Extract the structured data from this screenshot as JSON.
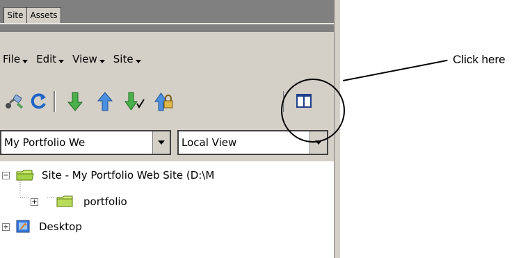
{
  "tabs": [
    "Site",
    "Assets"
  ],
  "menu": [
    "File",
    "Edit",
    "View",
    "Site"
  ],
  "toolbar": {
    "buttons": [
      "connect-icon",
      "refresh-icon",
      "get-icon",
      "put-icon",
      "check-out-icon",
      "check-in-icon",
      "expand-collapse-icon"
    ]
  },
  "site_select": {
    "value": "My Portfolio We"
  },
  "view_select": {
    "value": "Local View"
  },
  "tree": {
    "site_label": "Site - My Portfolio Web Site (D:\\M",
    "portfolio_label": "portfolio",
    "desktop_label": "Desktop"
  },
  "annotation": {
    "text": "Click here"
  },
  "colors": {
    "panel_bg": "#d4d0c8",
    "tab_strip": "#808080",
    "accent_green": "#2f9a3a",
    "accent_blue": "#1e63c8"
  }
}
